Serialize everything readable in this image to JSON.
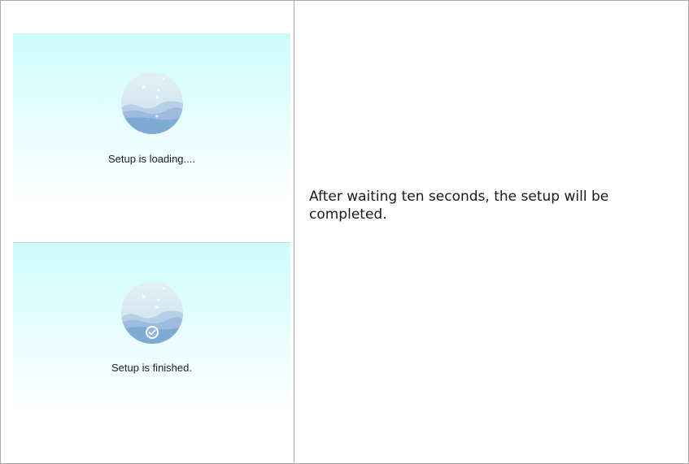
{
  "rows": [
    {
      "screens": [
        {
          "caption": "Setup is loading....",
          "illustration_icon": "ocean-globe-loading-icon",
          "colors": {
            "bg_top": "#ccfbfb",
            "bg_bottom": "#ffffff",
            "globe_sky": "#d5ecf4",
            "globe_water": "#7faad4"
          }
        },
        {
          "caption": "Setup is finished.",
          "illustration_icon": "ocean-globe-check-icon",
          "colors": {
            "bg_top": "#ccfbfb",
            "bg_bottom": "#ffffff",
            "check_badge": "#ffffff"
          }
        }
      ],
      "description": "After waiting ten seconds, the setup will be completed."
    }
  ]
}
